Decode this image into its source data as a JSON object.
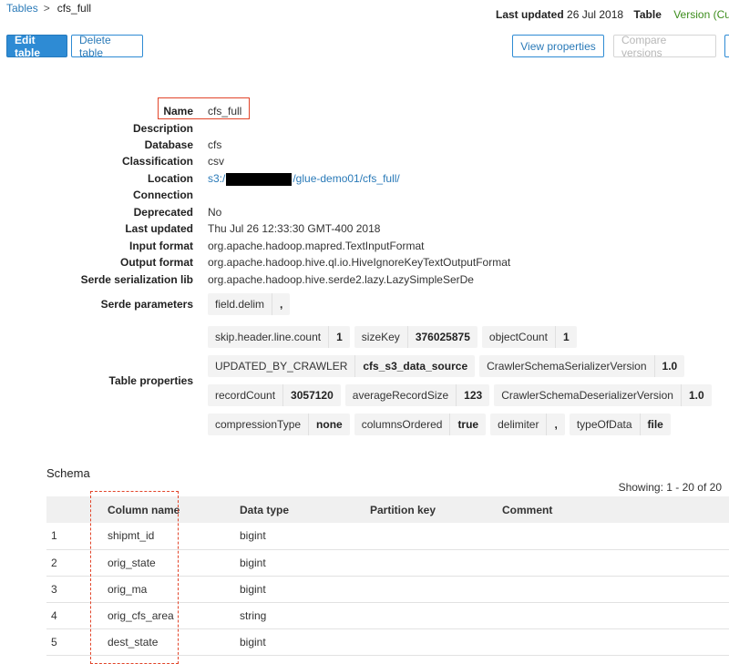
{
  "breadcrumb": {
    "parent": "Tables",
    "separator": ">",
    "current": "cfs_full"
  },
  "header": {
    "last_updated_label": "Last updated",
    "last_updated_value": "26 Jul 2018",
    "table_label": "Table",
    "version_status": "Version (Curre"
  },
  "toolbar": {
    "edit": "Edit table",
    "delete": "Delete table",
    "view_properties": "View properties",
    "compare_versions": "Compare versions"
  },
  "properties": {
    "name": {
      "label": "Name",
      "value": "cfs_full"
    },
    "description": {
      "label": "Description",
      "value": ""
    },
    "database": {
      "label": "Database",
      "value": "cfs"
    },
    "classification": {
      "label": "Classification",
      "value": "csv"
    },
    "location": {
      "label": "Location",
      "prefix": "s3:/",
      "suffix": "/glue-demo01/cfs_full/"
    },
    "connection": {
      "label": "Connection",
      "value": ""
    },
    "deprecated": {
      "label": "Deprecated",
      "value": "No"
    },
    "last_updated": {
      "label": "Last updated",
      "value": "Thu Jul 26 12:33:30 GMT-400 2018"
    },
    "input_format": {
      "label": "Input format",
      "value": "org.apache.hadoop.mapred.TextInputFormat"
    },
    "output_format": {
      "label": "Output format",
      "value": "org.apache.hadoop.hive.ql.io.HiveIgnoreKeyTextOutputFormat"
    },
    "serde_lib": {
      "label": "Serde serialization lib",
      "value": "org.apache.hadoop.hive.serde2.lazy.LazySimpleSerDe"
    },
    "serde_params": {
      "label": "Serde parameters",
      "items": [
        {
          "key": "field.delim",
          "value": ","
        }
      ]
    },
    "table_properties": {
      "label": "Table properties",
      "rows": [
        [
          {
            "key": "skip.header.line.count",
            "value": "1"
          },
          {
            "key": "sizeKey",
            "value": "376025875"
          },
          {
            "key": "objectCount",
            "value": "1"
          }
        ],
        [
          {
            "key": "UPDATED_BY_CRAWLER",
            "value": "cfs_s3_data_source"
          },
          {
            "key": "CrawlerSchemaSerializerVersion",
            "value": "1.0"
          }
        ],
        [
          {
            "key": "recordCount",
            "value": "3057120"
          },
          {
            "key": "averageRecordSize",
            "value": "123"
          },
          {
            "key": "CrawlerSchemaDeserializerVersion",
            "value": "1.0"
          }
        ],
        [
          {
            "key": "compressionType",
            "value": "none"
          },
          {
            "key": "columnsOrdered",
            "value": "true"
          },
          {
            "key": "delimiter",
            "value": ","
          },
          {
            "key": "typeOfData",
            "value": "file"
          }
        ]
      ]
    }
  },
  "schema": {
    "title": "Schema",
    "showing": "Showing: 1 - 20 of 20",
    "columns": [
      "",
      "Column name",
      "Data type",
      "Partition key",
      "Comment"
    ],
    "rows": [
      {
        "num": "1",
        "name": "shipmt_id",
        "type": "bigint",
        "partition": "",
        "comment": ""
      },
      {
        "num": "2",
        "name": "orig_state",
        "type": "bigint",
        "partition": "",
        "comment": ""
      },
      {
        "num": "3",
        "name": "orig_ma",
        "type": "bigint",
        "partition": "",
        "comment": ""
      },
      {
        "num": "4",
        "name": "orig_cfs_area",
        "type": "string",
        "partition": "",
        "comment": ""
      },
      {
        "num": "5",
        "name": "dest_state",
        "type": "bigint",
        "partition": "",
        "comment": ""
      }
    ]
  },
  "colors": {
    "primary": "#2e8bd4",
    "link": "#2a7ab8",
    "success": "#3c8d1c",
    "annotation": "#e2452a"
  }
}
